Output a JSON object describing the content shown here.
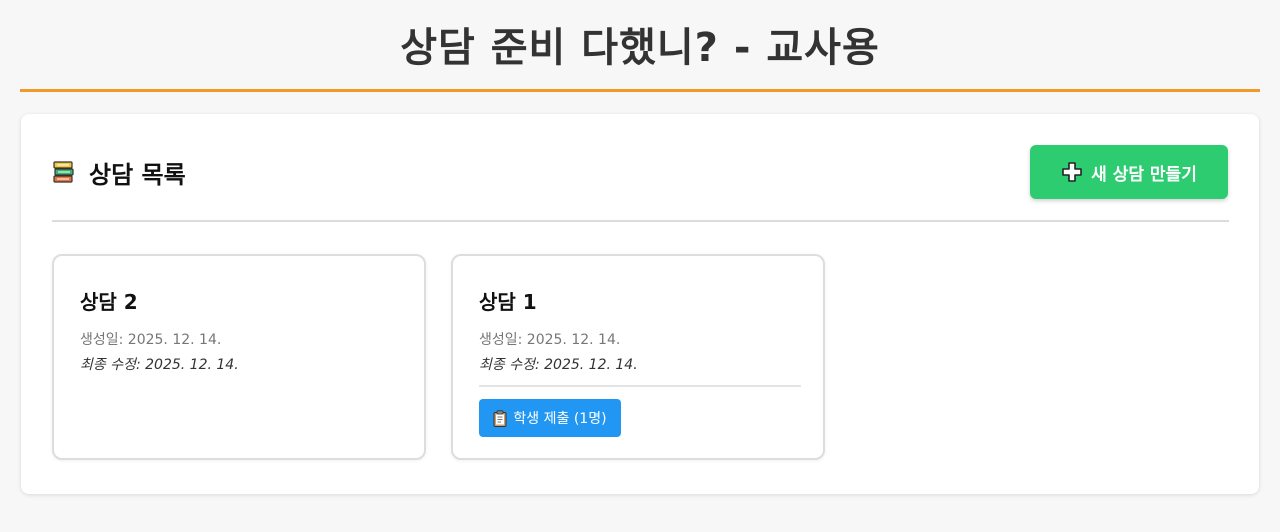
{
  "app": {
    "title": "상담 준비 다했니? - 교사용"
  },
  "panel": {
    "title": "상담 목록",
    "title_icon": "books-icon",
    "new_button": {
      "label": "새 상담 만들기",
      "icon": "plus-icon"
    }
  },
  "sessions": [
    {
      "title": "상담 2",
      "created": "생성일: 2025. 12. 14.",
      "modified": "최종 수정: 2025. 12. 14."
    },
    {
      "title": "상담 1",
      "created": "생성일: 2025. 12. 14.",
      "modified": "최종 수정: 2025. 12. 14.",
      "submission_button": {
        "label": "학생 제출 (1명)",
        "icon": "clipboard-icon"
      }
    }
  ],
  "colors": {
    "accent_orange": "#f09a2a",
    "new_button_green": "#2ecc71",
    "submit_button_blue": "#2196f3"
  }
}
